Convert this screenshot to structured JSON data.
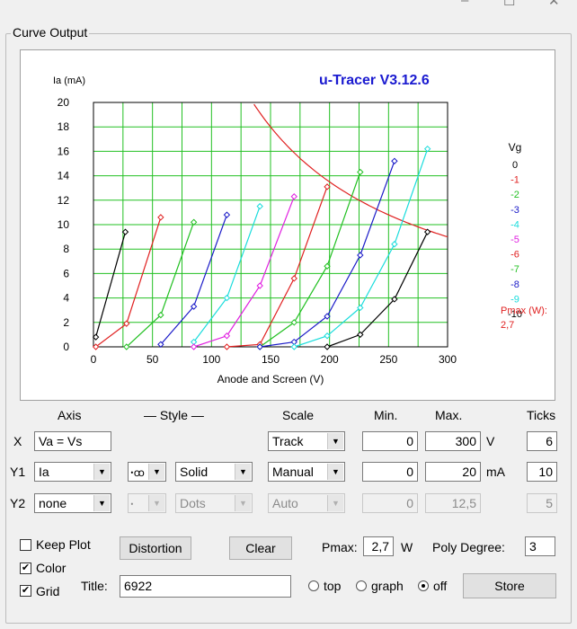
{
  "window": {
    "min_glyph": "–",
    "max_glyph": "☐",
    "close_glyph": "✕"
  },
  "group_title": "Curve Output",
  "chart_data": {
    "type": "line",
    "title": "u-Tracer V3.12.6",
    "ylabel": "Ia (mA)",
    "xlabel": "Anode and Screen (V)",
    "xlim": [
      0,
      300
    ],
    "ylim": [
      0,
      20
    ],
    "xticks": [
      0,
      50,
      100,
      150,
      200,
      250,
      300
    ],
    "yticks": [
      0,
      2,
      4,
      6,
      8,
      10,
      12,
      14,
      16,
      18,
      20
    ],
    "xgrid": [
      0,
      25,
      50,
      75,
      100,
      125,
      150,
      175,
      200,
      225,
      250,
      275,
      300
    ],
    "ygrid": [
      0,
      2,
      4,
      6,
      8,
      10,
      12,
      14,
      16,
      18,
      20
    ],
    "grid": true,
    "legend_title": "Vg",
    "series": [
      {
        "name": "0",
        "color": "#000000",
        "points": [
          [
            2,
            0.8
          ],
          [
            27,
            9.4
          ]
        ]
      },
      {
        "name": "-1",
        "color": "#e02020",
        "points": [
          [
            2,
            0
          ],
          [
            28,
            1.9
          ],
          [
            57,
            10.6
          ]
        ]
      },
      {
        "name": "-2",
        "color": "#22c022",
        "points": [
          [
            28,
            0
          ],
          [
            57,
            2.6
          ],
          [
            85,
            10.2
          ]
        ]
      },
      {
        "name": "-3",
        "color": "#1a1ac8",
        "points": [
          [
            57,
            0.2
          ],
          [
            85,
            3.3
          ],
          [
            113,
            10.8
          ]
        ]
      },
      {
        "name": "-4",
        "color": "#19dcdc",
        "points": [
          [
            85,
            0.4
          ],
          [
            113,
            4.0
          ],
          [
            141,
            11.5
          ]
        ]
      },
      {
        "name": "-5",
        "color": "#e020e0",
        "points": [
          [
            85,
            0
          ],
          [
            113,
            0.9
          ],
          [
            141,
            5.0
          ],
          [
            170,
            12.3
          ]
        ]
      },
      {
        "name": "-6",
        "color": "#e02020",
        "points": [
          [
            113,
            0
          ],
          [
            141,
            0.2
          ],
          [
            170,
            5.6
          ],
          [
            198,
            13.1
          ]
        ]
      },
      {
        "name": "-7",
        "color": "#22c022",
        "points": [
          [
            141,
            0
          ],
          [
            170,
            2.0
          ],
          [
            198,
            6.6
          ],
          [
            226,
            14.3
          ]
        ]
      },
      {
        "name": "-8",
        "color": "#1a1ac8",
        "points": [
          [
            141,
            0
          ],
          [
            170,
            0.4
          ],
          [
            198,
            2.5
          ],
          [
            226,
            7.5
          ],
          [
            255,
            15.2
          ]
        ]
      },
      {
        "name": "-9",
        "color": "#19dcdc",
        "points": [
          [
            170,
            0
          ],
          [
            198,
            0.9
          ],
          [
            226,
            3.2
          ],
          [
            255,
            8.4
          ],
          [
            283,
            16.2
          ]
        ]
      },
      {
        "name": "-10",
        "color": "#000000",
        "points": [
          [
            198,
            0
          ],
          [
            226,
            1.0
          ],
          [
            255,
            3.9
          ],
          [
            283,
            9.4
          ]
        ]
      }
    ],
    "pmax": {
      "label": "Pmax (W):",
      "value": "2,7",
      "color": "#e02020",
      "watts": 2.7
    }
  },
  "controls": {
    "headers": {
      "axis": "Axis",
      "style": "— Style —",
      "scale": "Scale",
      "min": "Min.",
      "max": "Max.",
      "ticks": "Ticks"
    },
    "rows": {
      "x": {
        "label": "X",
        "axis": "Va = Vs",
        "scale": "Track",
        "min": "0",
        "max": "300",
        "unit": "V",
        "ticks": "6"
      },
      "y1": {
        "label": "Y1",
        "axis": "Ia",
        "marker_icon": "ꞏꝏ",
        "style": "Solid",
        "scale": "Manual",
        "min": "0",
        "max": "20",
        "unit": "mA",
        "ticks": "10"
      },
      "y2": {
        "label": "Y2",
        "axis": "none",
        "marker_icon": "ꞏ",
        "style": "Dots",
        "scale": "Auto",
        "min": "0",
        "max": "12,5",
        "ticks": "5"
      }
    },
    "keep_plot": {
      "label": "Keep Plot",
      "checked": false
    },
    "color": {
      "label": "Color",
      "checked": true
    },
    "grid": {
      "label": "Grid",
      "checked": true
    },
    "distortion_button": "Distortion",
    "clear_button": "Clear",
    "pmax_label": "Pmax:",
    "pmax_value": "2,7",
    "pmax_unit": "W",
    "poly_degree_label": "Poly Degree:",
    "poly_degree_value": "3",
    "title_label": "Title:",
    "title_value": "6922",
    "legend_pos": {
      "top": "top",
      "graph": "graph",
      "off": "off",
      "selected": "off"
    },
    "store_button": "Store"
  }
}
